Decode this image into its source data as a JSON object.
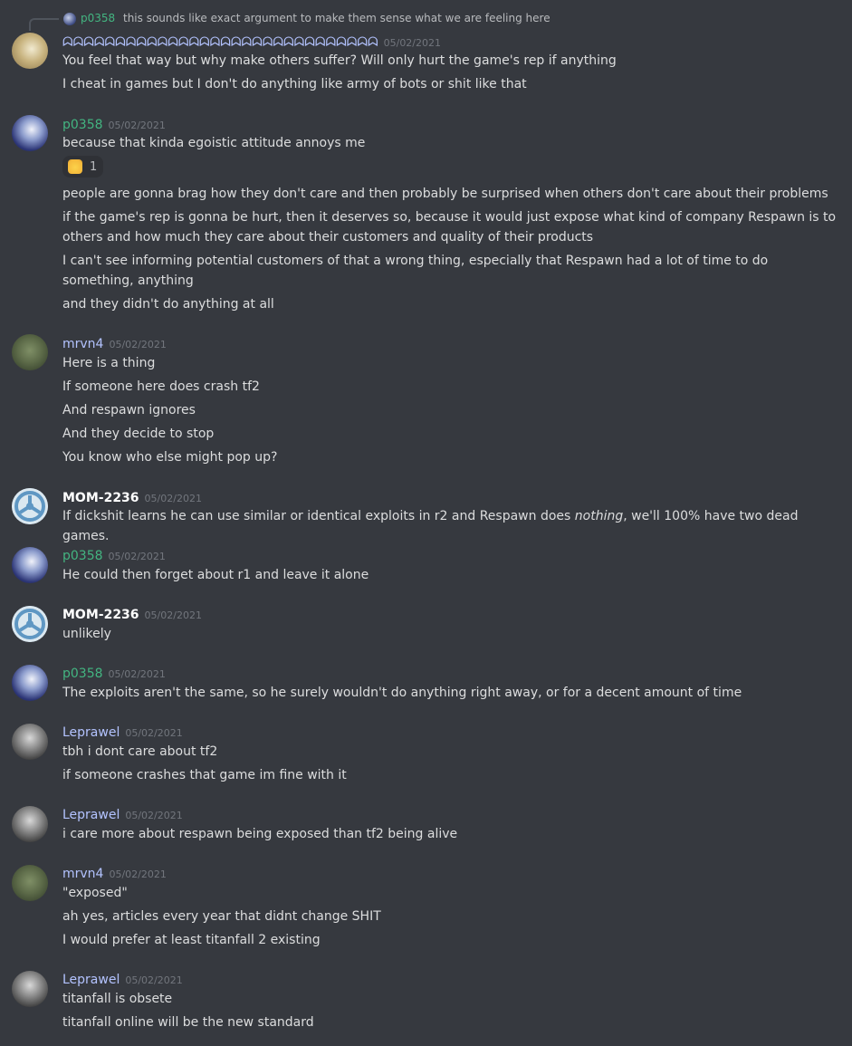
{
  "reply_preview": {
    "author": "p0358",
    "text": "this sounds like exact argument to make them sense what we are feeling here"
  },
  "messages": [
    {
      "author": "ᗣᗣᗣᗣᗣᗣᗣᗣᗣᗣᗣᗣᗣᗣᗣᗣᗣᗣᗣᗣᗣᗣᗣᗣᗣᗣᗣᗣᗣᗣ",
      "timestamp": "05/02/2021",
      "lines": [
        "You feel that way but why make others suffer? Will only hurt the game's rep if anything",
        "I cheat in games but I don't do anything like army of bots or shit like that"
      ]
    },
    {
      "author": "p0358",
      "timestamp": "05/02/2021",
      "lines": [
        "because that kinda egoistic attitude annoys me"
      ],
      "reaction": {
        "emoji": "fist-emoji",
        "count": "1"
      },
      "lines_after": [
        "people are gonna brag how they don't care and then probably be surprised when others don't care about their problems",
        "if the game's rep is gonna be hurt, then it deserves so, because it would just expose what kind of company Respawn is to others and how much they care about their customers and quality of their products",
        "I can't see informing potential customers of that a wrong thing, especially that Respawn had a lot of time to do something, anything",
        "and they didn't do anything at all"
      ]
    },
    {
      "author": "mrvn4",
      "timestamp": "05/02/2021",
      "lines": [
        "Here is a thing",
        "If someone here does crash tf2",
        "And respawn ignores",
        "And they decide to stop",
        "You know who else might pop up?"
      ]
    },
    {
      "author": "MOM-2236",
      "timestamp": "05/02/2021",
      "line_pre": "If dickshit learns he can use similar or identical exploits in r2 and Respawn does ",
      "line_em": "nothing",
      "line_post": ", we'll 100% have two dead games."
    },
    {
      "author": "p0358",
      "timestamp": "05/02/2021",
      "lines": [
        "He could then forget about r1 and leave it alone"
      ]
    },
    {
      "author": "MOM-2236",
      "timestamp": "05/02/2021",
      "lines": [
        "unlikely"
      ]
    },
    {
      "author": "p0358",
      "timestamp": "05/02/2021",
      "lines": [
        "The exploits aren't the same, so he surely wouldn't do anything right away, or for a decent amount of time"
      ]
    },
    {
      "author": "Leprawel",
      "timestamp": "05/02/2021",
      "lines": [
        "tbh i dont care about tf2",
        "if someone crashes that game im fine with it"
      ]
    },
    {
      "author": "Leprawel",
      "timestamp": "05/02/2021",
      "lines": [
        "i care more about respawn being exposed than tf2 being alive"
      ]
    },
    {
      "author": "mrvn4",
      "timestamp": "05/02/2021",
      "lines": [
        "\"exposed\"",
        "ah yes, articles every year that didnt change SHIT",
        "I would prefer at least titanfall 2 existing"
      ]
    },
    {
      "author": "Leprawel",
      "timestamp": "05/02/2021",
      "lines": [
        "titanfall is obsete",
        "titanfall online will be the new standard"
      ]
    }
  ],
  "colors": {
    "background": "#36393f",
    "text": "#dcddde",
    "timestamp": "#72767d",
    "author_green": "#43b581",
    "author_blue": "#b3c3ff",
    "author_white": "#ffffff"
  }
}
